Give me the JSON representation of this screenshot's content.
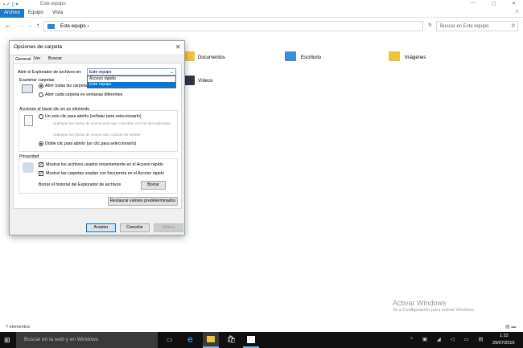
{
  "window": {
    "title": "Este equipo"
  },
  "ribbon": {
    "tabs": [
      "Archivo",
      "Equipo",
      "Vista"
    ]
  },
  "address": {
    "path": "Este equipo",
    "search_placeholder": "Buscar en Este equipo"
  },
  "content": {
    "items": [
      "Documentos",
      "Escritorio",
      "Imágenes",
      "Vídeos"
    ]
  },
  "status": {
    "count": "7 elementos"
  },
  "watermark": {
    "title": "Activar Windows",
    "subtitle": "Ve a Configuración para activar Windows."
  },
  "dialog": {
    "title": "Opciones de carpeta",
    "tabs": [
      "General",
      "Ver",
      "Buscar"
    ],
    "open_label": "Abrir el Explorador de archivos en:",
    "open_value": "Este equipo",
    "open_options": [
      "Acceso rápido",
      "Este equipo"
    ],
    "browse_title": "Examinar carpetas",
    "browse_options": [
      "Abrir todas las carpetas en la misma ventana",
      "Abrir cada carpeta en ventanas diferentes"
    ],
    "click_title": "Acciones al hacer clic en un elemento",
    "click_single": "Un solo clic para abrirlo (señalar para seleccionarlo)",
    "click_sub1": "Subrayar los títulos de iconos para que coincidan con los del explorador",
    "click_sub2": "Subrayar los títulos de iconos solo cuando los señale",
    "click_double": "Doble clic para abrirlo (un clic para seleccionarlo)",
    "privacy_title": "Privacidad",
    "privacy_recent": "Mostrar los archivos usados recientemente en el Acceso rápido",
    "privacy_frequent": "Mostrar las carpetas usadas con frecuencia en el Acceso rápido",
    "clear_label": "Borrar el historial del Explorador de archivos",
    "clear_button": "Borrar",
    "restore_button": "Restaurar valores predeterminados",
    "ok": "Aceptar",
    "cancel": "Cancelar",
    "apply": "Aplicar"
  },
  "taskbar": {
    "search_placeholder": "Buscar en la web y en Windows",
    "time": "1:33",
    "date": "29/07/2015"
  }
}
